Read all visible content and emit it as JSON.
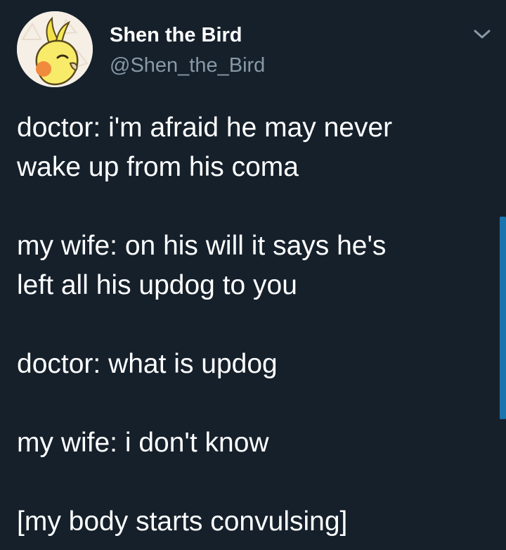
{
  "tweet": {
    "author": {
      "display_name": "Shen the Bird",
      "handle": "@Shen_the_Bird",
      "avatar_icon": "cockatiel-avatar-icon"
    },
    "menu_icon": "chevron-down-icon",
    "lines": [
      "doctor: i'm afraid he may never",
      "wake up from his coma",
      "",
      "my wife: on his will it says he's",
      "left all his updog to you",
      "",
      "doctor: what is updog",
      "",
      "my wife: i don't know",
      "",
      "[my body starts convulsing]"
    ]
  },
  "colors": {
    "background": "#15202b",
    "primary_text": "#ffffff",
    "secondary_text": "#8899a6",
    "accent": "#1da1f2"
  }
}
